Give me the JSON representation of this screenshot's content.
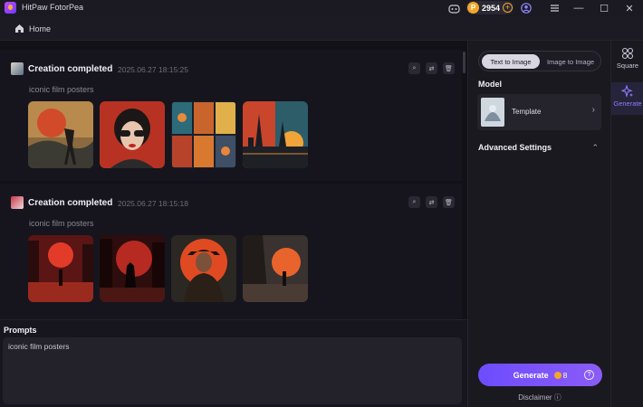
{
  "app": {
    "title": "HitPaw FotorPea",
    "coins": "2954",
    "coin_symbol": "P",
    "plus": "+",
    "minimize": "—",
    "maximize": "☐",
    "close": "✕"
  },
  "nav": {
    "home_label": "Home"
  },
  "creations": [
    {
      "title": "Creation completed",
      "timestamp": "2025.06.27 18:15:25",
      "prompt": "iconic film posters",
      "image_count": 4
    },
    {
      "title": "Creation completed",
      "timestamp": "2025.06.27 18:15:18",
      "prompt": "iconic film posters",
      "image_count": 4
    }
  ],
  "prompts": {
    "label": "Prompts",
    "value": "iconic film posters"
  },
  "panel": {
    "mode_tabs": [
      "Text to Image",
      "Image to Image"
    ],
    "active_mode": "Text to Image",
    "model_label": "Model",
    "model_name": "Template",
    "advanced_label": "Advanced Settings",
    "generate_label": "Generate",
    "generate_cost": "8",
    "help": "?",
    "disclaimer": "Disclaimer ⓘ"
  },
  "sidebar": [
    {
      "label": "Square",
      "icon": "square-grid-icon",
      "active": false
    },
    {
      "label": "Generate",
      "icon": "sparkle-icon",
      "active": true
    }
  ],
  "colors": {
    "accent": "#7c5cff",
    "coin": "#f3a72a",
    "background": "#15141b"
  }
}
